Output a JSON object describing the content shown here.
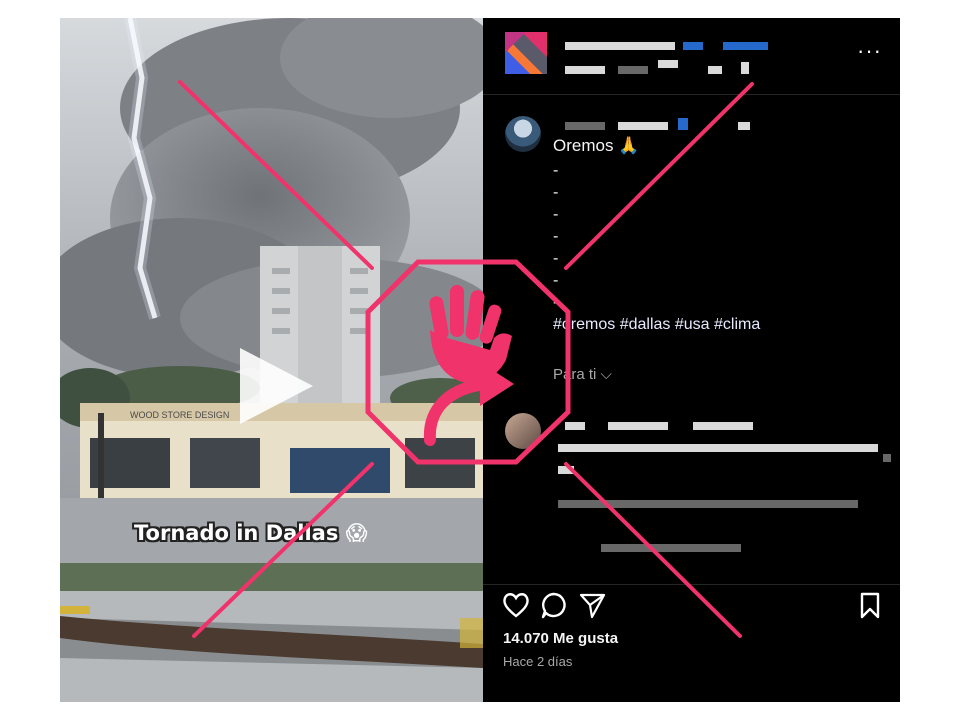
{
  "video": {
    "caption": "Tornado in Dallas",
    "caption_emoji": "😱",
    "storefront_sign": "WOOD STORE DESIGN"
  },
  "post": {
    "more_label": "···",
    "comment_text": "Oremos 🙏",
    "dashes": [
      "-",
      "-",
      "-",
      "-",
      "-",
      "-",
      "-"
    ],
    "hashtags": "#oremos #dallas #usa #clima",
    "translation_link": "Para ti ⌵",
    "likes": "14.070 Me gusta",
    "timestamp": "Hace 2 días"
  },
  "icons": {
    "like": "heart-icon",
    "comment": "comment-icon",
    "share": "share-icon",
    "save": "bookmark-icon",
    "stamp": "stop-hand-icon"
  },
  "colors": {
    "stamp": "#f0336b",
    "panel_bg": "#000000",
    "hashtag": "#e8eaff"
  }
}
